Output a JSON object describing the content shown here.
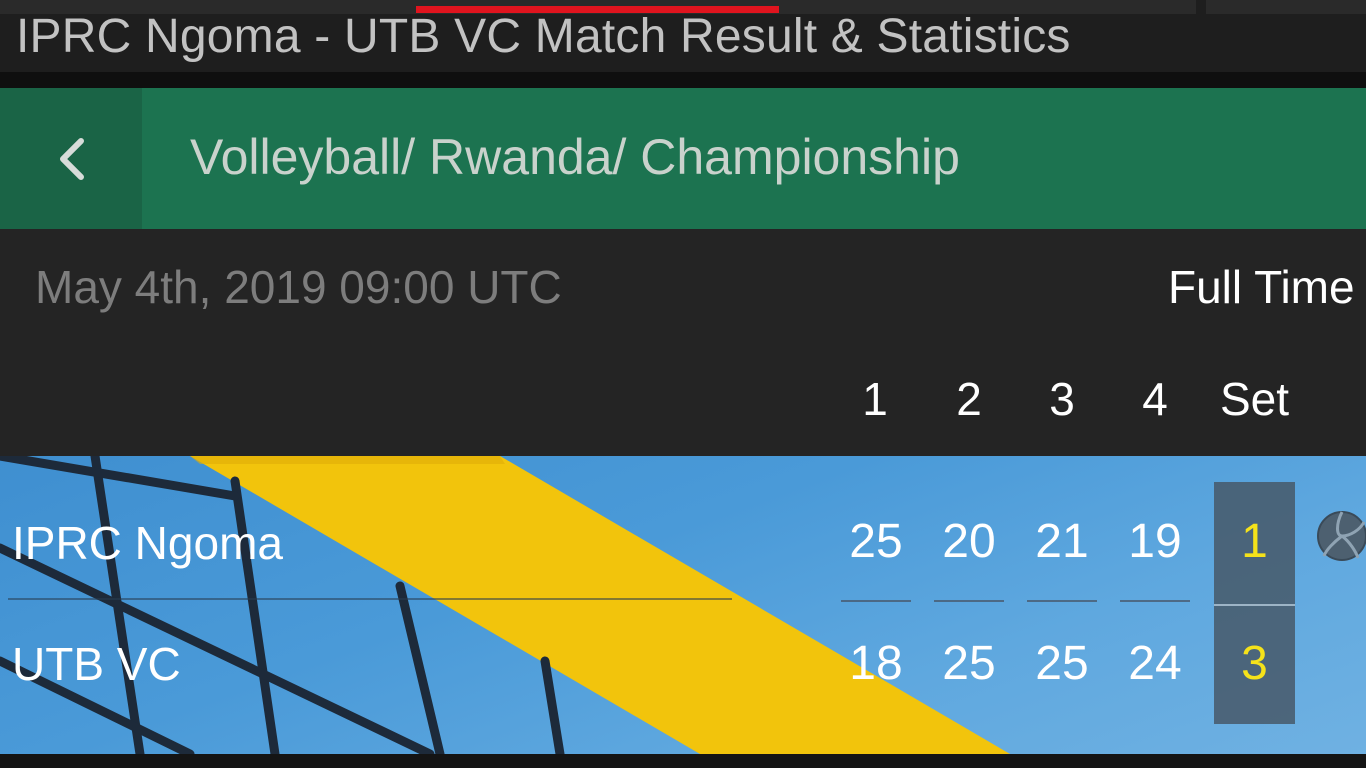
{
  "window": {
    "title": "IPRC Ngoma - UTB VC Match Result & Statistics"
  },
  "breadcrumb": {
    "back_icon": "chevron-left-icon",
    "text": "Volleyball/ Rwanda/ Championship"
  },
  "match": {
    "date": "May 4th, 2019 09:00 UTC",
    "status": "Full Time",
    "columns": [
      "1",
      "2",
      "3",
      "4",
      "Set"
    ],
    "teams": [
      {
        "name": "IPRC Ngoma",
        "sets": [
          "25",
          "20",
          "21",
          "19"
        ],
        "total": "1",
        "serve_icon": "volleyball-icon"
      },
      {
        "name": "UTB VC",
        "sets": [
          "18",
          "25",
          "25",
          "24"
        ],
        "total": "3"
      }
    ]
  },
  "colors": {
    "header_green": "#1c7350",
    "back_button_green": "#1a6446",
    "accent_red": "#e0141e",
    "set_value_yellow": "#f5e21a",
    "panel_blue": "#4a9ad8"
  }
}
